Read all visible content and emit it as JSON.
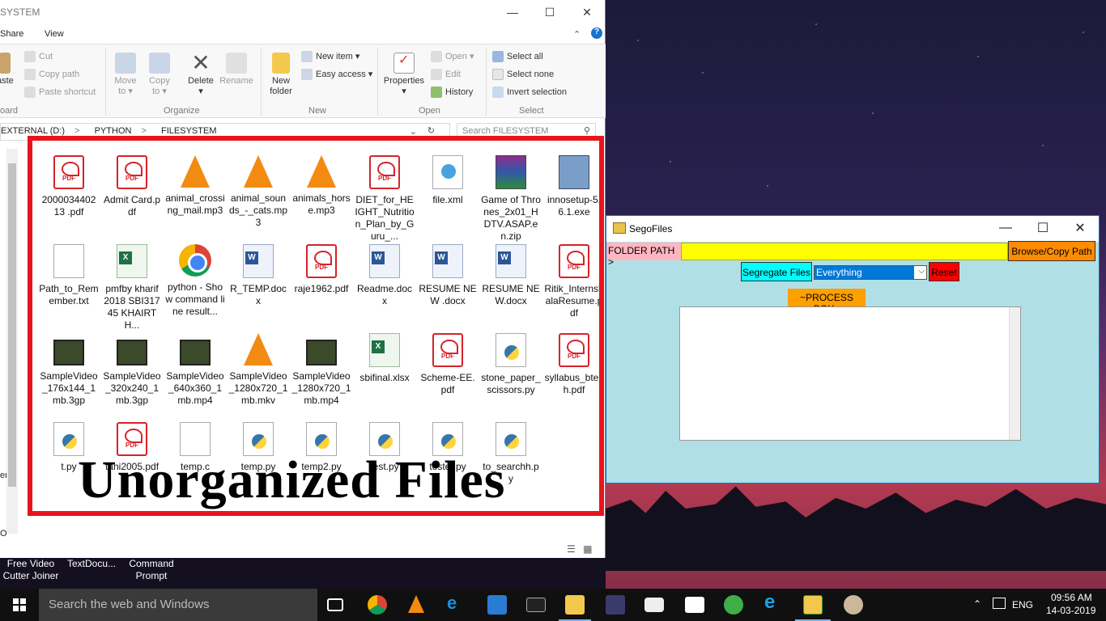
{
  "explorer": {
    "title": "SYSTEM",
    "menu": [
      "Share",
      "View"
    ],
    "ribbon": {
      "cut": "Cut",
      "copy_path": "Copy path",
      "paste_shortcut": "Paste shortcut",
      "paste_partial": "aste",
      "clipboard_partial": "oard",
      "move_to": "Move to",
      "copy_to": "Copy to",
      "delete": "Delete",
      "rename": "Rename",
      "organize": "Organize",
      "new_folder": "New folder",
      "new_item": "New item",
      "easy_access": "Easy access",
      "new": "New",
      "properties": "Properties",
      "open": "Open",
      "edit": "Edit",
      "history": "History",
      "open_group": "Open",
      "select_all": "Select all",
      "select_none": "Select none",
      "invert_selection": "Invert selection",
      "select_group": "Select"
    },
    "breadcrumb": [
      "EXTERNAL (D:)",
      "PYTHON",
      "FILESYSTEM"
    ],
    "search_placeholder": "Search FILESYSTEM",
    "nav_partial": [
      "en",
      "O"
    ],
    "files": [
      {
        "name": "2000034402 13 .pdf",
        "type": "pdf"
      },
      {
        "name": "Admit Card.pdf",
        "type": "pdf"
      },
      {
        "name": "animal_crossing_mail.mp3",
        "type": "vlc"
      },
      {
        "name": "animal_sounds_-_cats.mp3",
        "type": "vlc"
      },
      {
        "name": "animals_horse.mp3",
        "type": "vlc"
      },
      {
        "name": "DIET_for_HEIGHT_Nutrition_Plan_by_Guru_...",
        "type": "pdf"
      },
      {
        "name": "file.xml",
        "type": "xml"
      },
      {
        "name": "Game of Thrones_2x01_HDTV.ASAP.en.zip",
        "type": "rar"
      },
      {
        "name": "innosetup-5.6.1.exe",
        "type": "exe"
      },
      {
        "name": "Path_to_Remember.txt",
        "type": "txt"
      },
      {
        "name": "pmfby kharif 2018 SBI31745 KHAIRTH...",
        "type": "xls"
      },
      {
        "name": "python - Show command line result...",
        "type": "chrome"
      },
      {
        "name": "R_TEMP.docx",
        "type": "doc"
      },
      {
        "name": "raje1962.pdf",
        "type": "pdf"
      },
      {
        "name": "Readme.docx",
        "type": "doc"
      },
      {
        "name": "RESUME NEW .docx",
        "type": "doc"
      },
      {
        "name": "RESUME NEW.docx",
        "type": "doc"
      },
      {
        "name": "Ritik_InternshalaResume.pdf",
        "type": "pdf"
      },
      {
        "name": "SampleVideo_176x144_1mb.3gp",
        "type": "video"
      },
      {
        "name": "SampleVideo_320x240_1mb.3gp",
        "type": "video"
      },
      {
        "name": "SampleVideo_640x360_1mb.mp4",
        "type": "video"
      },
      {
        "name": "SampleVideo_1280x720_1mb.mkv",
        "type": "vlc"
      },
      {
        "name": "SampleVideo_1280x720_1mb.mp4",
        "type": "video"
      },
      {
        "name": "sbifinal.xlsx",
        "type": "xls"
      },
      {
        "name": "Scheme-EE.pdf",
        "type": "pdf"
      },
      {
        "name": "stone_paper_scissors.py",
        "type": "py"
      },
      {
        "name": "syllabus_btech.pdf",
        "type": "pdf"
      },
      {
        "name": "t.py",
        "type": "py"
      },
      {
        "name": "tani2005.pdf",
        "type": "pdf"
      },
      {
        "name": "temp.c",
        "type": "blank"
      },
      {
        "name": "temp.py",
        "type": "py"
      },
      {
        "name": "temp2.py",
        "type": "py"
      },
      {
        "name": "test.py",
        "type": "py"
      },
      {
        "name": "tester.py",
        "type": "py"
      },
      {
        "name": "to_searchh.py",
        "type": "py"
      }
    ],
    "overlay_text": "Unorganized Files"
  },
  "desktop_shortcuts": [
    {
      "label": "Free Video Cutter Joiner"
    },
    {
      "label": "TextDocu..."
    },
    {
      "label": "Command Prompt"
    }
  ],
  "sego": {
    "title": "SegoFiles",
    "folder_path_label": "FOLDER PATH >",
    "folder_path_value": "",
    "browse_label": "Browse/Copy Path",
    "segregate_label": "Segregate Files",
    "filter_value": "Everything",
    "reset_label": "Reset",
    "process_box_label": "~PROCESS BOX~",
    "process_box_text": "",
    "colors": {
      "bg": "#b0e0e6",
      "path_field": "#ffff00",
      "browse": "#ff8c00",
      "segregate": "#00ffff",
      "reset": "#ff0000",
      "process_label": "#ff9f00"
    }
  },
  "taskbar": {
    "search_placeholder": "Search the web and Windows",
    "language": "ENG",
    "time": "09:56 AM",
    "date": "14-03-2019",
    "icons": [
      "task-view-icon",
      "chrome-icon",
      "vlc-icon",
      "edge-icon",
      "vscode-icon",
      "cmd-icon",
      "file-explorer-icon",
      "media-icon",
      "camera-icon",
      "store-icon",
      "globe-icon",
      "ie-icon",
      "sego-folder-icon",
      "paint-icon"
    ]
  }
}
